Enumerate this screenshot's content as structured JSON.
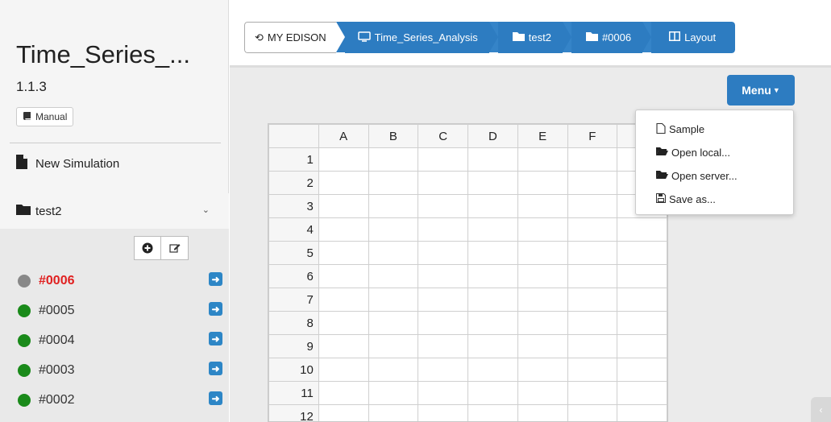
{
  "app": {
    "title": "Time_Series_...",
    "version": "1.1.3",
    "manual_label": "Manual",
    "new_simulation_label": "New Simulation",
    "folder_label": "test2"
  },
  "jobs": [
    {
      "label": "#0006",
      "status_color": "#888888",
      "active": true
    },
    {
      "label": "#0005",
      "status_color": "#1a8a1a",
      "active": false
    },
    {
      "label": "#0004",
      "status_color": "#1a8a1a",
      "active": false
    },
    {
      "label": "#0003",
      "status_color": "#1a8a1a",
      "active": false
    },
    {
      "label": "#0002",
      "status_color": "#1a8a1a",
      "active": false
    }
  ],
  "breadcrumb": {
    "home": "MY EDISON",
    "app": "Time_Series_Analysis",
    "folder": "test2",
    "job": "#0006",
    "layout": "Layout"
  },
  "menu": {
    "button_label": "Menu",
    "items": [
      "Sample",
      "Open local...",
      "Open server...",
      "Save as..."
    ]
  },
  "grid": {
    "columns": [
      "A",
      "B",
      "C",
      "D",
      "E",
      "F",
      ""
    ],
    "rows": [
      "1",
      "2",
      "3",
      "4",
      "5",
      "6",
      "7",
      "8",
      "9",
      "10",
      "11",
      "12"
    ]
  },
  "colors": {
    "accent": "#2d7cc1",
    "active_job": "#e02020"
  }
}
